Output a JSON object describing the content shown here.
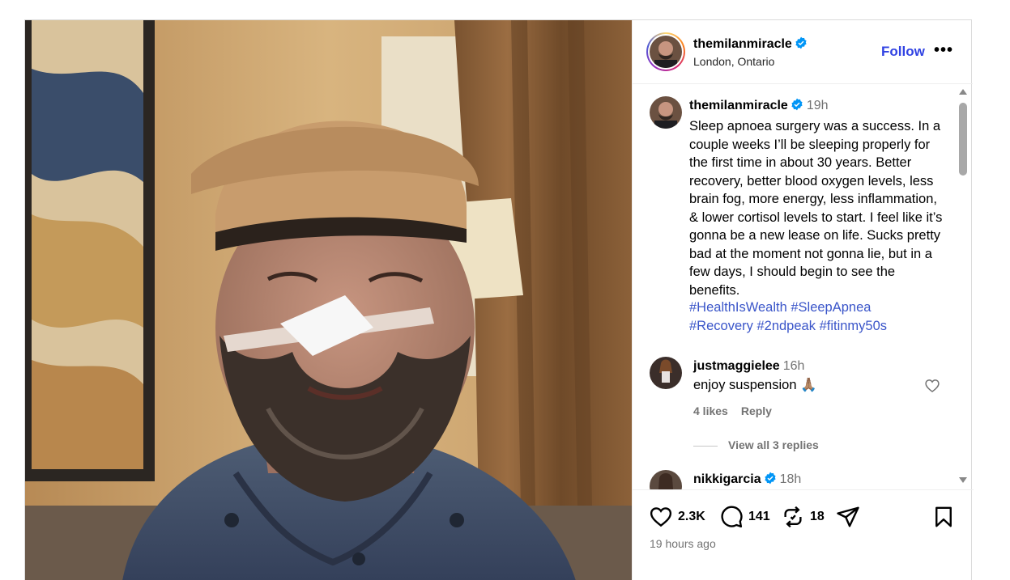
{
  "post_header": {
    "username": "themilanmiracle",
    "location": "London, Ontario",
    "follow_label": "Follow",
    "more_label": "•••"
  },
  "caption": {
    "username": "themilanmiracle",
    "time": "19h",
    "text": "Sleep apnoea surgery was a success. In a couple weeks I’ll be sleeping properly for the first time in about 30 years. Better recovery, better blood oxygen levels, less brain fog, more energy, less inflammation, & lower cortisol levels to start. I feel like it’s gonna be a new lease on life. Sucks pretty bad at the moment not gonna lie, but in a few days, I should begin to see the benefits.",
    "hashtags": [
      "#HealthIsWealth",
      "#SleepApnea",
      "#Recovery",
      "#2ndpeak",
      "#fitinmy50s"
    ]
  },
  "comments": [
    {
      "username": "justmaggielee",
      "time": "16h",
      "text": "enjoy suspension 🙏🏽",
      "likes": "4 likes",
      "reply_label": "Reply",
      "view_replies": "View all 3 replies"
    },
    {
      "username": "nikkigarcia",
      "time": "18h"
    }
  ],
  "actions": {
    "likes_count": "2.3K",
    "comments_count": "141",
    "reposts_count": "18",
    "time_ago": "19 hours ago"
  },
  "icons": {
    "verified": "verified-badge-icon",
    "like": "heart-icon",
    "comment": "comment-bubble-icon",
    "repost": "repost-icon",
    "share": "paper-plane-icon",
    "save": "bookmark-icon"
  },
  "colors": {
    "link_blue": "#3143e3",
    "hashtag_blue": "#3a55c9",
    "verified_blue": "#0095f6",
    "muted_gray": "#737373"
  }
}
